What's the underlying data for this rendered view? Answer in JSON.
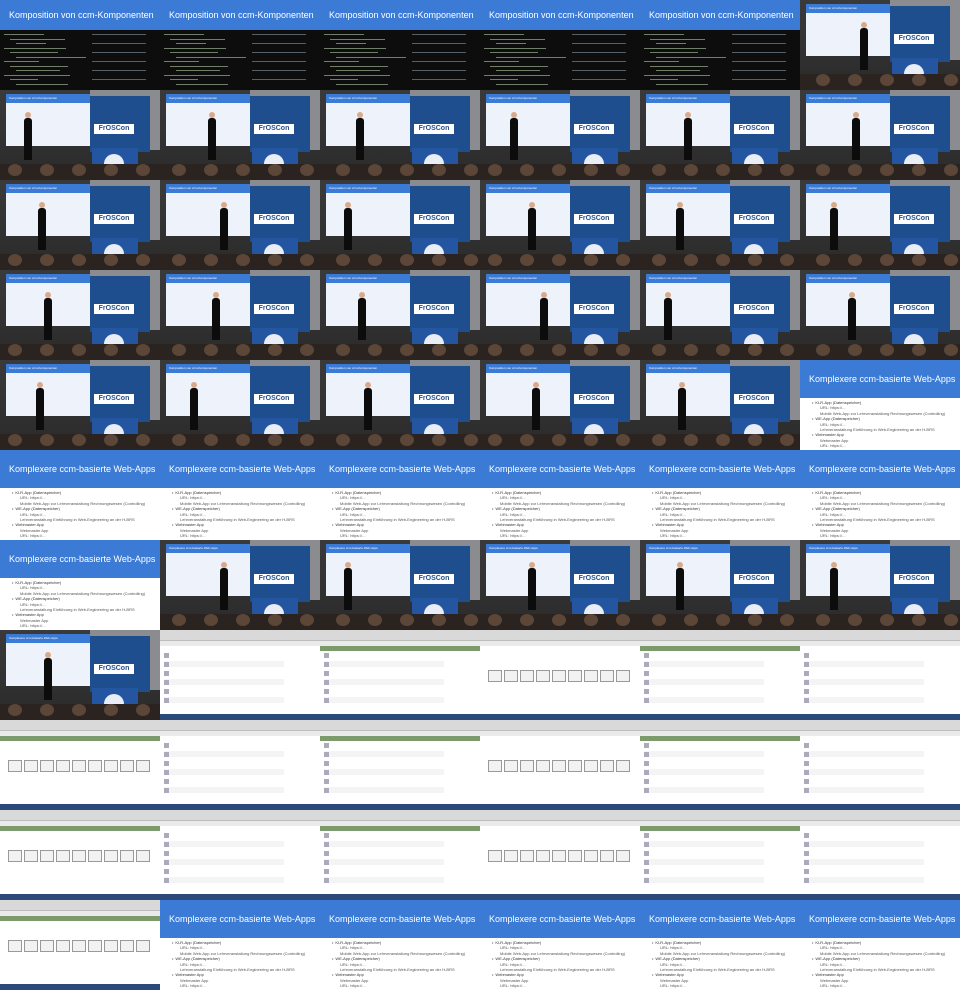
{
  "code_title": "Komposition von ccm-Komponenten",
  "webapps_title": "Komplexere ccm-basierte Web-Apps",
  "stage_logo": "FrOSCon 11",
  "webapps_body": [
    {
      "level": 1,
      "text": "KLR-App (Datenspeicher)"
    },
    {
      "level": 2,
      "text": "URL: https://..."
    },
    {
      "level": 2,
      "text": "Mobile Web-App zur Lehrveranstaltung Rechnungswesen (Controlling)"
    },
    {
      "level": 1,
      "text": "WE-App (Datenspeicher)"
    },
    {
      "level": 2,
      "text": "URL: https://..."
    },
    {
      "level": 2,
      "text": "Lehrveranstaltung Einführung in Web-Engineering an der H-BRS"
    },
    {
      "level": 1,
      "text": "Webmaster App"
    },
    {
      "level": 2,
      "text": "Webmaster App"
    },
    {
      "level": 2,
      "text": "URL: https://..."
    }
  ],
  "colors": {
    "accent": "#3b7bd6",
    "terminal": "#0d0d0d",
    "app_green": "#7d9a6c",
    "banner": "#1f4e8f"
  },
  "tiles": [
    "code",
    "code",
    "code",
    "code",
    "code",
    "stage",
    "stage",
    "stage",
    "stage",
    "stage",
    "stage",
    "stage",
    "stage",
    "stage",
    "stage",
    "stage",
    "stage",
    "stage",
    "stage",
    "stage",
    "stage",
    "stage",
    "stage",
    "stage",
    "stage",
    "stage",
    "stage",
    "stage",
    "stage",
    "slide",
    "slide",
    "slide",
    "slide",
    "slide",
    "slide",
    "slide",
    "slide",
    "stage",
    "stage",
    "stage",
    "stage",
    "stage",
    "stage",
    "desk",
    "desk",
    "desk",
    "desk",
    "desk",
    "desk",
    "desk",
    "desk",
    "desk",
    "desk",
    "desk",
    "desk",
    "desk",
    "desk",
    "desk",
    "desk",
    "desk",
    "desk",
    "slide",
    "slide",
    "slide",
    "slide",
    "slide"
  ]
}
